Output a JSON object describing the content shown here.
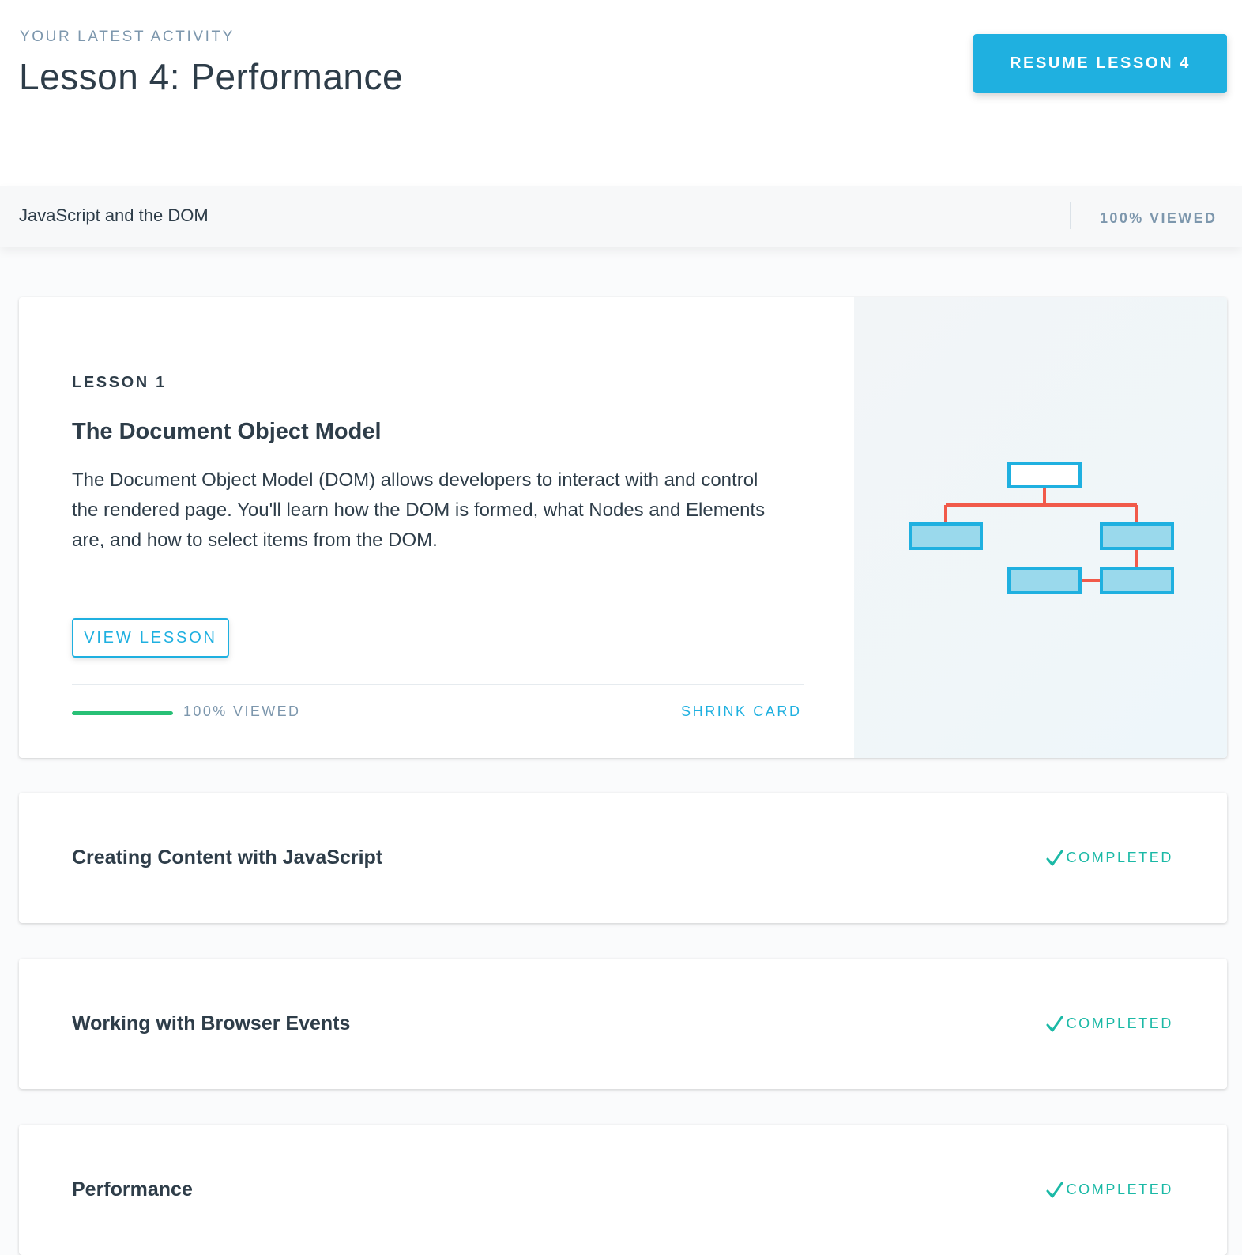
{
  "header": {
    "eyebrow": "YOUR LATEST ACTIVITY",
    "title": "Lesson 4: Performance",
    "resume_button": "RESUME LESSON 4"
  },
  "module": {
    "title": "JavaScript and the DOM",
    "progress": "100% VIEWED"
  },
  "expanded_card": {
    "kicker": "LESSON 1",
    "title": "The Document Object Model",
    "description": "The Document Object Model (DOM) allows developers to interact with and control the rendered page. You'll learn how the DOM is formed, what Nodes and Elements are, and how to select items from the DOM.",
    "view_button": "VIEW LESSON",
    "progress_value": 1.0,
    "progress_label": "100% VIEWED",
    "shrink_link": "SHRINK CARD",
    "illustration": "dom-tree-icon"
  },
  "lessons": [
    {
      "title": "Creating Content with JavaScript",
      "status": "COMPLETED"
    },
    {
      "title": "Working with Browser Events",
      "status": "COMPLETED"
    },
    {
      "title": "Performance",
      "status": "COMPLETED"
    }
  ],
  "colors": {
    "accent": "#1fb0e0",
    "success": "#28c076",
    "completed": "#1bb9a6",
    "muted": "#7d97ad",
    "text": "#2e3d49",
    "tree_line": "#f15a4a"
  }
}
